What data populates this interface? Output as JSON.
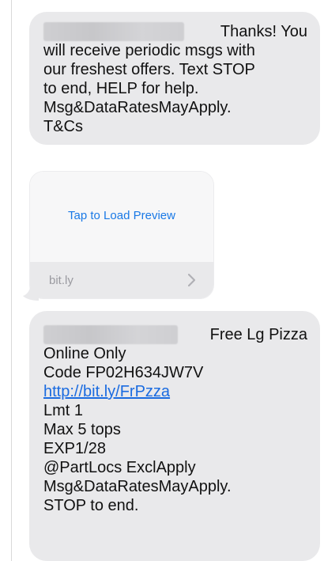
{
  "messages": [
    {
      "sender_redacted": true,
      "lines": [
        "Thanks! You",
        "will receive periodic msgs with",
        "our freshest offers. Text STOP",
        "to end, HELP for help.",
        "Msg&DataRatesMayApply.",
        "T&Cs"
      ]
    },
    {
      "type": "link_preview",
      "action_label": "Tap to Load Preview",
      "domain": "bit.ly",
      "chevron_icon": "chevron-right-icon"
    },
    {
      "sender_redacted": true,
      "lines": [
        "Free Lg Pizza",
        "Online Only",
        "Code FP02H634JW7V",
        "http://bit.ly/FrPzza",
        "Lmt 1",
        "Max 5 tops",
        "EXP1/28",
        "@PartLocs ExclApply",
        "Msg&DataRatesMayApply.",
        "STOP to end."
      ],
      "link_line_index": 3
    }
  ],
  "colors": {
    "bubble": "#e9e9eb",
    "link": "#1a79e6",
    "text": "#111111",
    "domain_text": "#9a9aa0"
  }
}
